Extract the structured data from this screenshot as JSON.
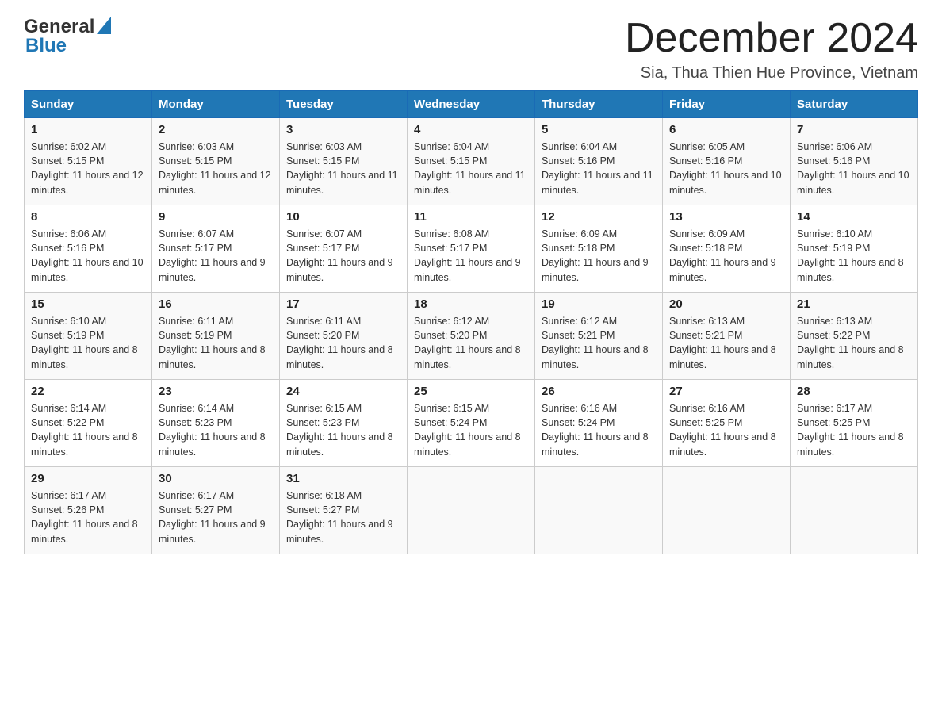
{
  "header": {
    "logo_general": "General",
    "logo_blue": "Blue",
    "month_title": "December 2024",
    "location": "Sia, Thua Thien Hue Province, Vietnam"
  },
  "weekdays": [
    "Sunday",
    "Monday",
    "Tuesday",
    "Wednesday",
    "Thursday",
    "Friday",
    "Saturday"
  ],
  "weeks": [
    [
      {
        "day": "1",
        "sunrise": "6:02 AM",
        "sunset": "5:15 PM",
        "daylight": "11 hours and 12 minutes."
      },
      {
        "day": "2",
        "sunrise": "6:03 AM",
        "sunset": "5:15 PM",
        "daylight": "11 hours and 12 minutes."
      },
      {
        "day": "3",
        "sunrise": "6:03 AM",
        "sunset": "5:15 PM",
        "daylight": "11 hours and 11 minutes."
      },
      {
        "day": "4",
        "sunrise": "6:04 AM",
        "sunset": "5:15 PM",
        "daylight": "11 hours and 11 minutes."
      },
      {
        "day": "5",
        "sunrise": "6:04 AM",
        "sunset": "5:16 PM",
        "daylight": "11 hours and 11 minutes."
      },
      {
        "day": "6",
        "sunrise": "6:05 AM",
        "sunset": "5:16 PM",
        "daylight": "11 hours and 10 minutes."
      },
      {
        "day": "7",
        "sunrise": "6:06 AM",
        "sunset": "5:16 PM",
        "daylight": "11 hours and 10 minutes."
      }
    ],
    [
      {
        "day": "8",
        "sunrise": "6:06 AM",
        "sunset": "5:16 PM",
        "daylight": "11 hours and 10 minutes."
      },
      {
        "day": "9",
        "sunrise": "6:07 AM",
        "sunset": "5:17 PM",
        "daylight": "11 hours and 9 minutes."
      },
      {
        "day": "10",
        "sunrise": "6:07 AM",
        "sunset": "5:17 PM",
        "daylight": "11 hours and 9 minutes."
      },
      {
        "day": "11",
        "sunrise": "6:08 AM",
        "sunset": "5:17 PM",
        "daylight": "11 hours and 9 minutes."
      },
      {
        "day": "12",
        "sunrise": "6:09 AM",
        "sunset": "5:18 PM",
        "daylight": "11 hours and 9 minutes."
      },
      {
        "day": "13",
        "sunrise": "6:09 AM",
        "sunset": "5:18 PM",
        "daylight": "11 hours and 9 minutes."
      },
      {
        "day": "14",
        "sunrise": "6:10 AM",
        "sunset": "5:19 PM",
        "daylight": "11 hours and 8 minutes."
      }
    ],
    [
      {
        "day": "15",
        "sunrise": "6:10 AM",
        "sunset": "5:19 PM",
        "daylight": "11 hours and 8 minutes."
      },
      {
        "day": "16",
        "sunrise": "6:11 AM",
        "sunset": "5:19 PM",
        "daylight": "11 hours and 8 minutes."
      },
      {
        "day": "17",
        "sunrise": "6:11 AM",
        "sunset": "5:20 PM",
        "daylight": "11 hours and 8 minutes."
      },
      {
        "day": "18",
        "sunrise": "6:12 AM",
        "sunset": "5:20 PM",
        "daylight": "11 hours and 8 minutes."
      },
      {
        "day": "19",
        "sunrise": "6:12 AM",
        "sunset": "5:21 PM",
        "daylight": "11 hours and 8 minutes."
      },
      {
        "day": "20",
        "sunrise": "6:13 AM",
        "sunset": "5:21 PM",
        "daylight": "11 hours and 8 minutes."
      },
      {
        "day": "21",
        "sunrise": "6:13 AM",
        "sunset": "5:22 PM",
        "daylight": "11 hours and 8 minutes."
      }
    ],
    [
      {
        "day": "22",
        "sunrise": "6:14 AM",
        "sunset": "5:22 PM",
        "daylight": "11 hours and 8 minutes."
      },
      {
        "day": "23",
        "sunrise": "6:14 AM",
        "sunset": "5:23 PM",
        "daylight": "11 hours and 8 minutes."
      },
      {
        "day": "24",
        "sunrise": "6:15 AM",
        "sunset": "5:23 PM",
        "daylight": "11 hours and 8 minutes."
      },
      {
        "day": "25",
        "sunrise": "6:15 AM",
        "sunset": "5:24 PM",
        "daylight": "11 hours and 8 minutes."
      },
      {
        "day": "26",
        "sunrise": "6:16 AM",
        "sunset": "5:24 PM",
        "daylight": "11 hours and 8 minutes."
      },
      {
        "day": "27",
        "sunrise": "6:16 AM",
        "sunset": "5:25 PM",
        "daylight": "11 hours and 8 minutes."
      },
      {
        "day": "28",
        "sunrise": "6:17 AM",
        "sunset": "5:25 PM",
        "daylight": "11 hours and 8 minutes."
      }
    ],
    [
      {
        "day": "29",
        "sunrise": "6:17 AM",
        "sunset": "5:26 PM",
        "daylight": "11 hours and 8 minutes."
      },
      {
        "day": "30",
        "sunrise": "6:17 AM",
        "sunset": "5:27 PM",
        "daylight": "11 hours and 9 minutes."
      },
      {
        "day": "31",
        "sunrise": "6:18 AM",
        "sunset": "5:27 PM",
        "daylight": "11 hours and 9 minutes."
      },
      null,
      null,
      null,
      null
    ]
  ]
}
